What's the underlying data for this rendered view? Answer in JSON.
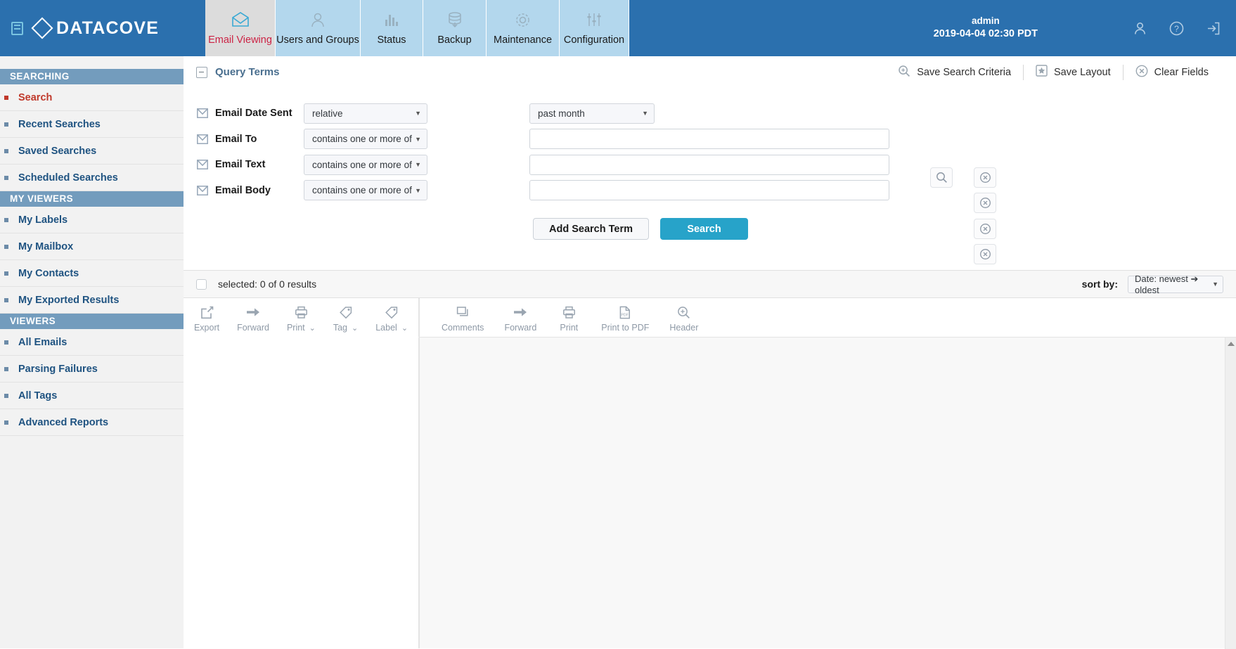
{
  "header": {
    "panel_toggle_icon": "panel-toggle-icon",
    "brand": "DATACOVE",
    "tabs": [
      {
        "label": "Email Viewing",
        "icon": "envelope-icon",
        "active": true
      },
      {
        "label": "Users and Groups",
        "icon": "user-group-icon",
        "active": false
      },
      {
        "label": "Status",
        "icon": "bar-chart-icon",
        "active": false
      },
      {
        "label": "Backup",
        "icon": "database-download-icon",
        "active": false
      },
      {
        "label": "Maintenance",
        "icon": "gear-icon",
        "active": false
      },
      {
        "label": "Configuration",
        "icon": "sliders-icon",
        "active": false
      }
    ],
    "user_name": "admin",
    "user_time": "2019-04-04 02:30 PDT",
    "icons": [
      "user-icon",
      "help-icon",
      "logout-icon"
    ]
  },
  "sidebar": {
    "groups": [
      {
        "title": "SEARCHING",
        "items": [
          {
            "label": "Search",
            "active": true
          },
          {
            "label": "Recent Searches",
            "active": false
          },
          {
            "label": "Saved Searches",
            "active": false
          },
          {
            "label": "Scheduled Searches",
            "active": false
          }
        ]
      },
      {
        "title": "MY VIEWERS",
        "items": [
          {
            "label": "My Labels",
            "active": false
          },
          {
            "label": "My Mailbox",
            "active": false
          },
          {
            "label": "My Contacts",
            "active": false
          },
          {
            "label": "My Exported Results",
            "active": false
          }
        ]
      },
      {
        "title": "VIEWERS",
        "items": [
          {
            "label": "All Emails",
            "active": false
          },
          {
            "label": "Parsing Failures",
            "active": false
          },
          {
            "label": "All Tags",
            "active": false
          },
          {
            "label": "Advanced Reports",
            "active": false
          }
        ]
      }
    ]
  },
  "query_panel": {
    "title": "Query Terms",
    "collapse_icon": "collapse-minus-icon",
    "actions": [
      {
        "label": "Save Search Criteria",
        "icon": "magnifier-plus-icon"
      },
      {
        "label": "Save Layout",
        "icon": "star-box-icon"
      },
      {
        "label": "Clear Fields",
        "icon": "circle-x-icon"
      }
    ],
    "rows": [
      {
        "label": "Email Date Sent",
        "icon": "envelope-icon",
        "operator": "relative",
        "value_select": "past month",
        "has_text_input": false,
        "remove_icon": "circle-x-icon"
      },
      {
        "label": "Email To",
        "icon": "envelope-icon",
        "operator": "contains one or more of",
        "text_value": "",
        "text_placeholder": "",
        "has_text_input": true,
        "remove_icon": "circle-x-icon"
      },
      {
        "label": "Email Text",
        "icon": "envelope-icon",
        "operator": "contains one or more of",
        "text_value": "",
        "text_placeholder": "",
        "has_text_input": true,
        "remove_icon": "circle-x-icon"
      },
      {
        "label": "Email Body",
        "icon": "envelope-icon",
        "operator": "contains one or more of",
        "text_value": "",
        "text_placeholder": "",
        "has_text_input": true,
        "remove_icon": "circle-x-icon"
      }
    ],
    "lookup_icon": "magnifier-icon",
    "add_term_label": "Add Search Term",
    "search_label": "Search"
  },
  "results_bar": {
    "selected_text": "selected: 0 of 0 results",
    "sort_label": "sort by:",
    "sort_value": "Date: newest ➔ oldest"
  },
  "toolbar_left": [
    {
      "label": "Export",
      "icon": "export-icon",
      "caret": false
    },
    {
      "label": "Forward",
      "icon": "forward-arrow-icon",
      "caret": false
    },
    {
      "label": "Print",
      "icon": "printer-icon",
      "caret": true
    },
    {
      "label": "Tag",
      "icon": "tag-icon",
      "caret": true
    },
    {
      "label": "Label",
      "icon": "label-icon",
      "caret": true
    }
  ],
  "toolbar_right": [
    {
      "label": "Comments",
      "icon": "comment-icon",
      "caret": false
    },
    {
      "label": "Forward",
      "icon": "forward-arrow-icon",
      "caret": false
    },
    {
      "label": "Print",
      "icon": "printer-icon",
      "caret": false
    },
    {
      "label": "Print to PDF",
      "icon": "pdf-file-icon",
      "caret": false
    },
    {
      "label": "Header",
      "icon": "magnifier-plus-icon",
      "caret": false
    }
  ],
  "colors": {
    "header_blue": "#2b70ae",
    "tab_blue": "#b3d7ed",
    "active_tab_gray": "#dcdcdc",
    "active_tab_text": "#cc2244",
    "sidebar_bg": "#f2f2f2",
    "sidebar_section": "#739cbd",
    "sidebar_link": "#1f5381",
    "primary_button": "#27a3c9"
  }
}
